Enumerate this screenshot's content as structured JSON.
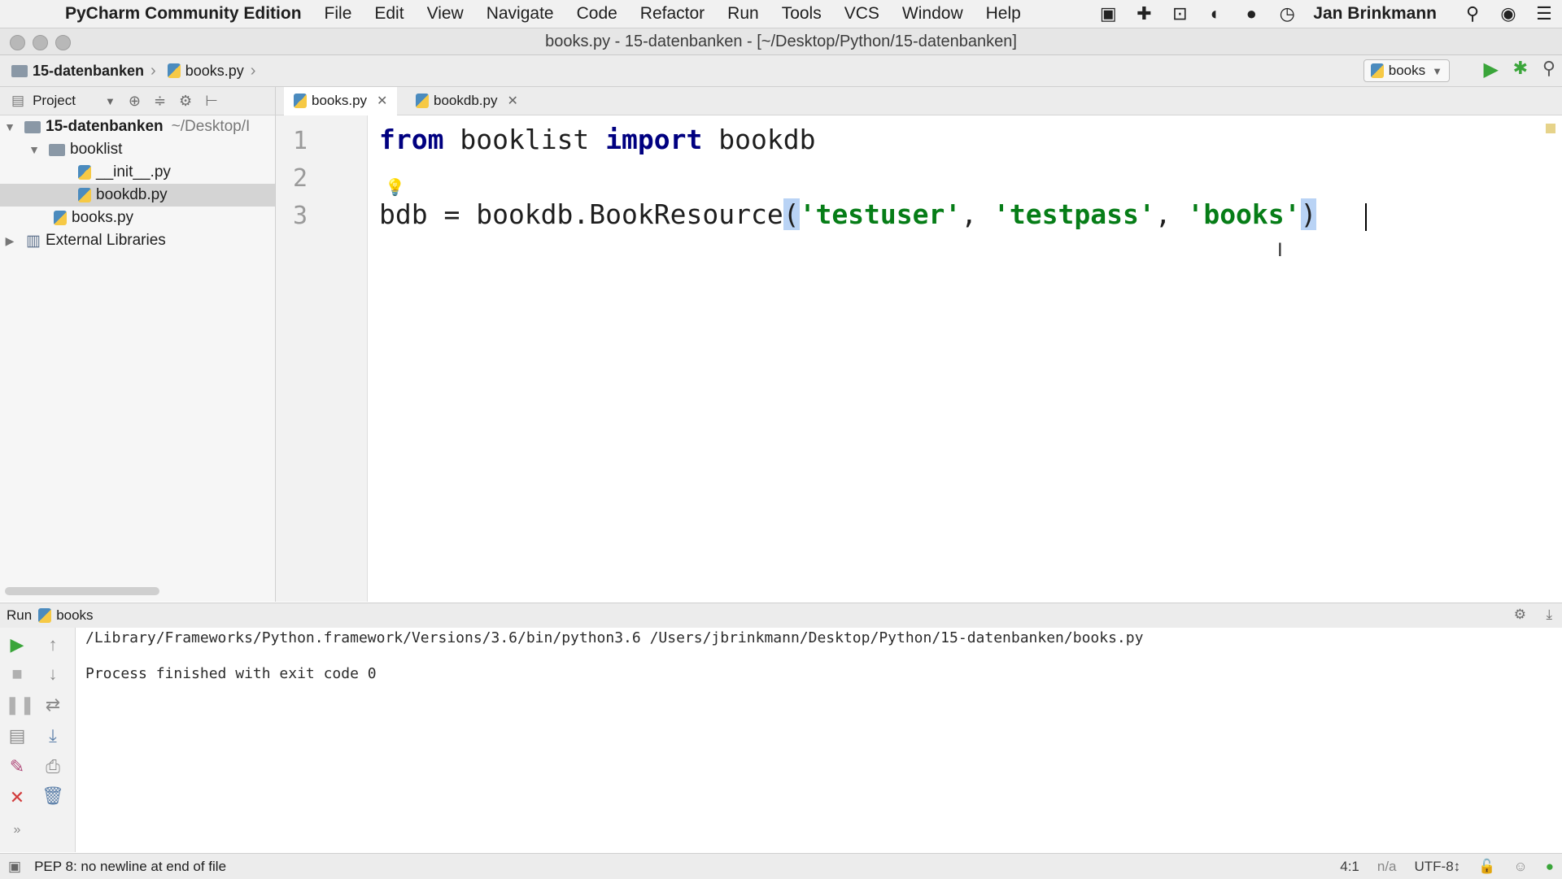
{
  "menubar": {
    "app_name": "PyCharm Community Edition",
    "menus": [
      "File",
      "Edit",
      "View",
      "Navigate",
      "Code",
      "Refactor",
      "Run",
      "Tools",
      "VCS",
      "Window",
      "Help"
    ],
    "user": "Jan Brinkmann"
  },
  "window": {
    "title": "books.py - 15-datenbanken - [~/Desktop/Python/15-datenbanken]"
  },
  "navbar": {
    "breadcrumb_root": "15-datenbanken",
    "breadcrumb_file": "books.py",
    "run_config": "books"
  },
  "project_panel": {
    "label": "Project",
    "tree": {
      "root_name": "15-datenbanken",
      "root_path": "~/Desktop/I",
      "folder_booklist": "booklist",
      "file_init": "__init__.py",
      "file_bookdb": "bookdb.py",
      "file_books": "books.py",
      "external": "External Libraries"
    }
  },
  "editor": {
    "tabs": [
      {
        "label": "books.py",
        "active": true
      },
      {
        "label": "bookdb.py",
        "active": false
      }
    ],
    "line_numbers": [
      "1",
      "2",
      "3"
    ],
    "line1": {
      "kw_from": "from",
      "module": "booklist",
      "kw_import": "import",
      "name": "bookdb"
    },
    "line3": {
      "prefix": "bdb = bookdb.BookResource",
      "open_paren": "(",
      "arg1": "'testuser'",
      "sep1": ", ",
      "arg2": "'testpass'",
      "sep2": ", ",
      "arg3": "'books'",
      "close_paren": ")"
    }
  },
  "run_panel": {
    "label": "Run",
    "config": "books",
    "output_command": "/Library/Frameworks/Python.framework/Versions/3.6/bin/python3.6 /Users/jbrinkmann/Desktop/Python/15-datenbanken/books.py",
    "output_exit": "Process finished with exit code 0"
  },
  "status_bar": {
    "message": "PEP 8: no newline at end of file",
    "position": "4:1",
    "line_sep": "n/a",
    "encoding": "UTF-8↕"
  },
  "colors": {
    "keyword": "#000080",
    "string": "#067d17",
    "run_green": "#3aa53a",
    "stop_red": "#d23b3b"
  }
}
